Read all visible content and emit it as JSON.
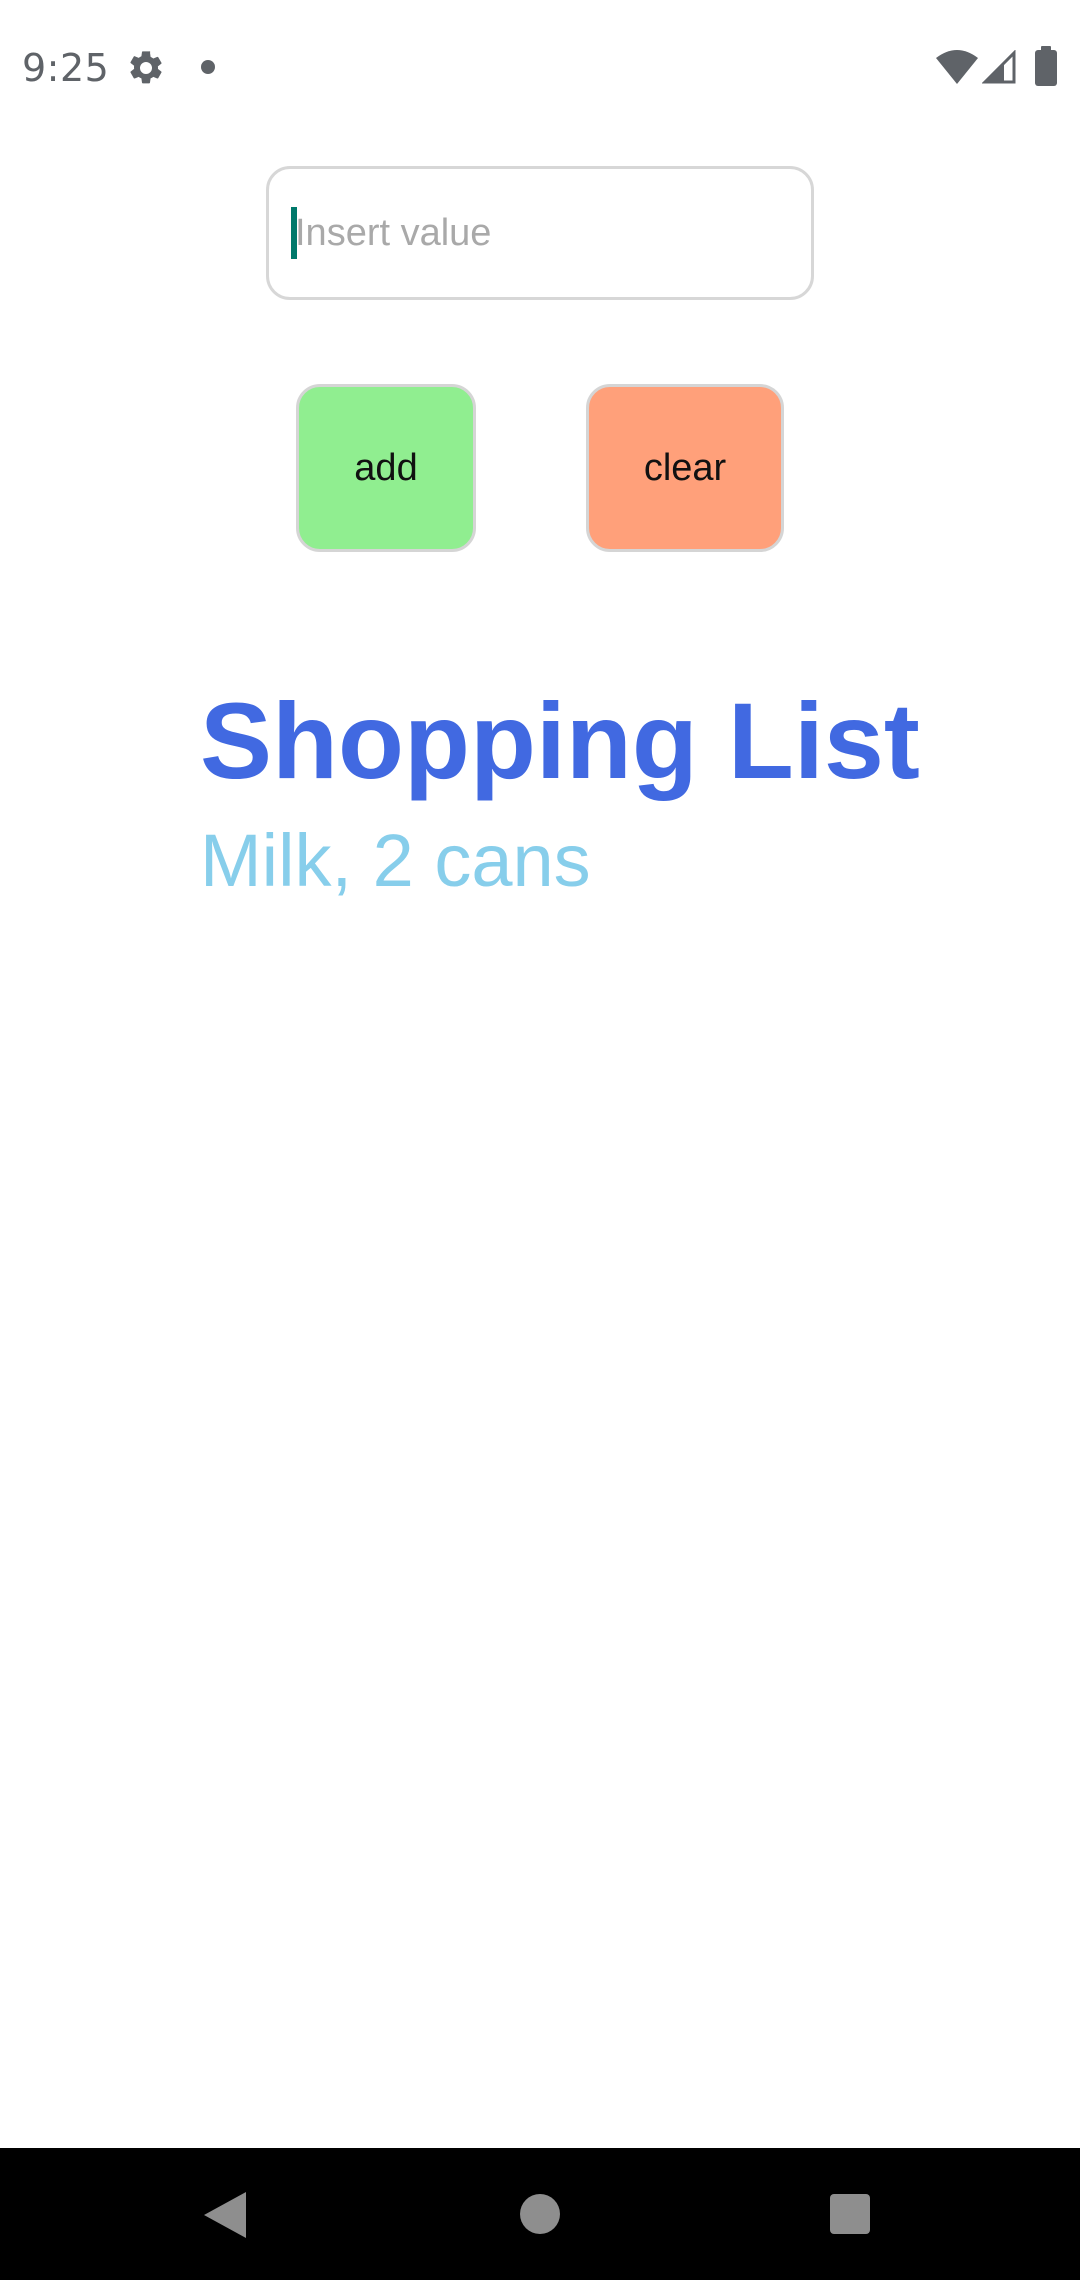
{
  "status_bar": {
    "time": "9:25",
    "icons": [
      "gear-icon",
      "notification-dot-icon",
      "wifi-icon",
      "cell-signal-icon",
      "battery-icon"
    ]
  },
  "input": {
    "placeholder": "Insert value",
    "value": ""
  },
  "buttons": {
    "add_label": "add",
    "add_color": "#90EE90",
    "clear_label": "clear",
    "clear_color": "#FFA07A"
  },
  "list": {
    "title": "Shopping List",
    "title_color": "#4169E1",
    "items": [
      "Milk, 2 cans"
    ],
    "item_color": "#87CEEB"
  },
  "nav_bar": {
    "icons": [
      "back-icon",
      "home-icon",
      "recents-icon"
    ]
  }
}
